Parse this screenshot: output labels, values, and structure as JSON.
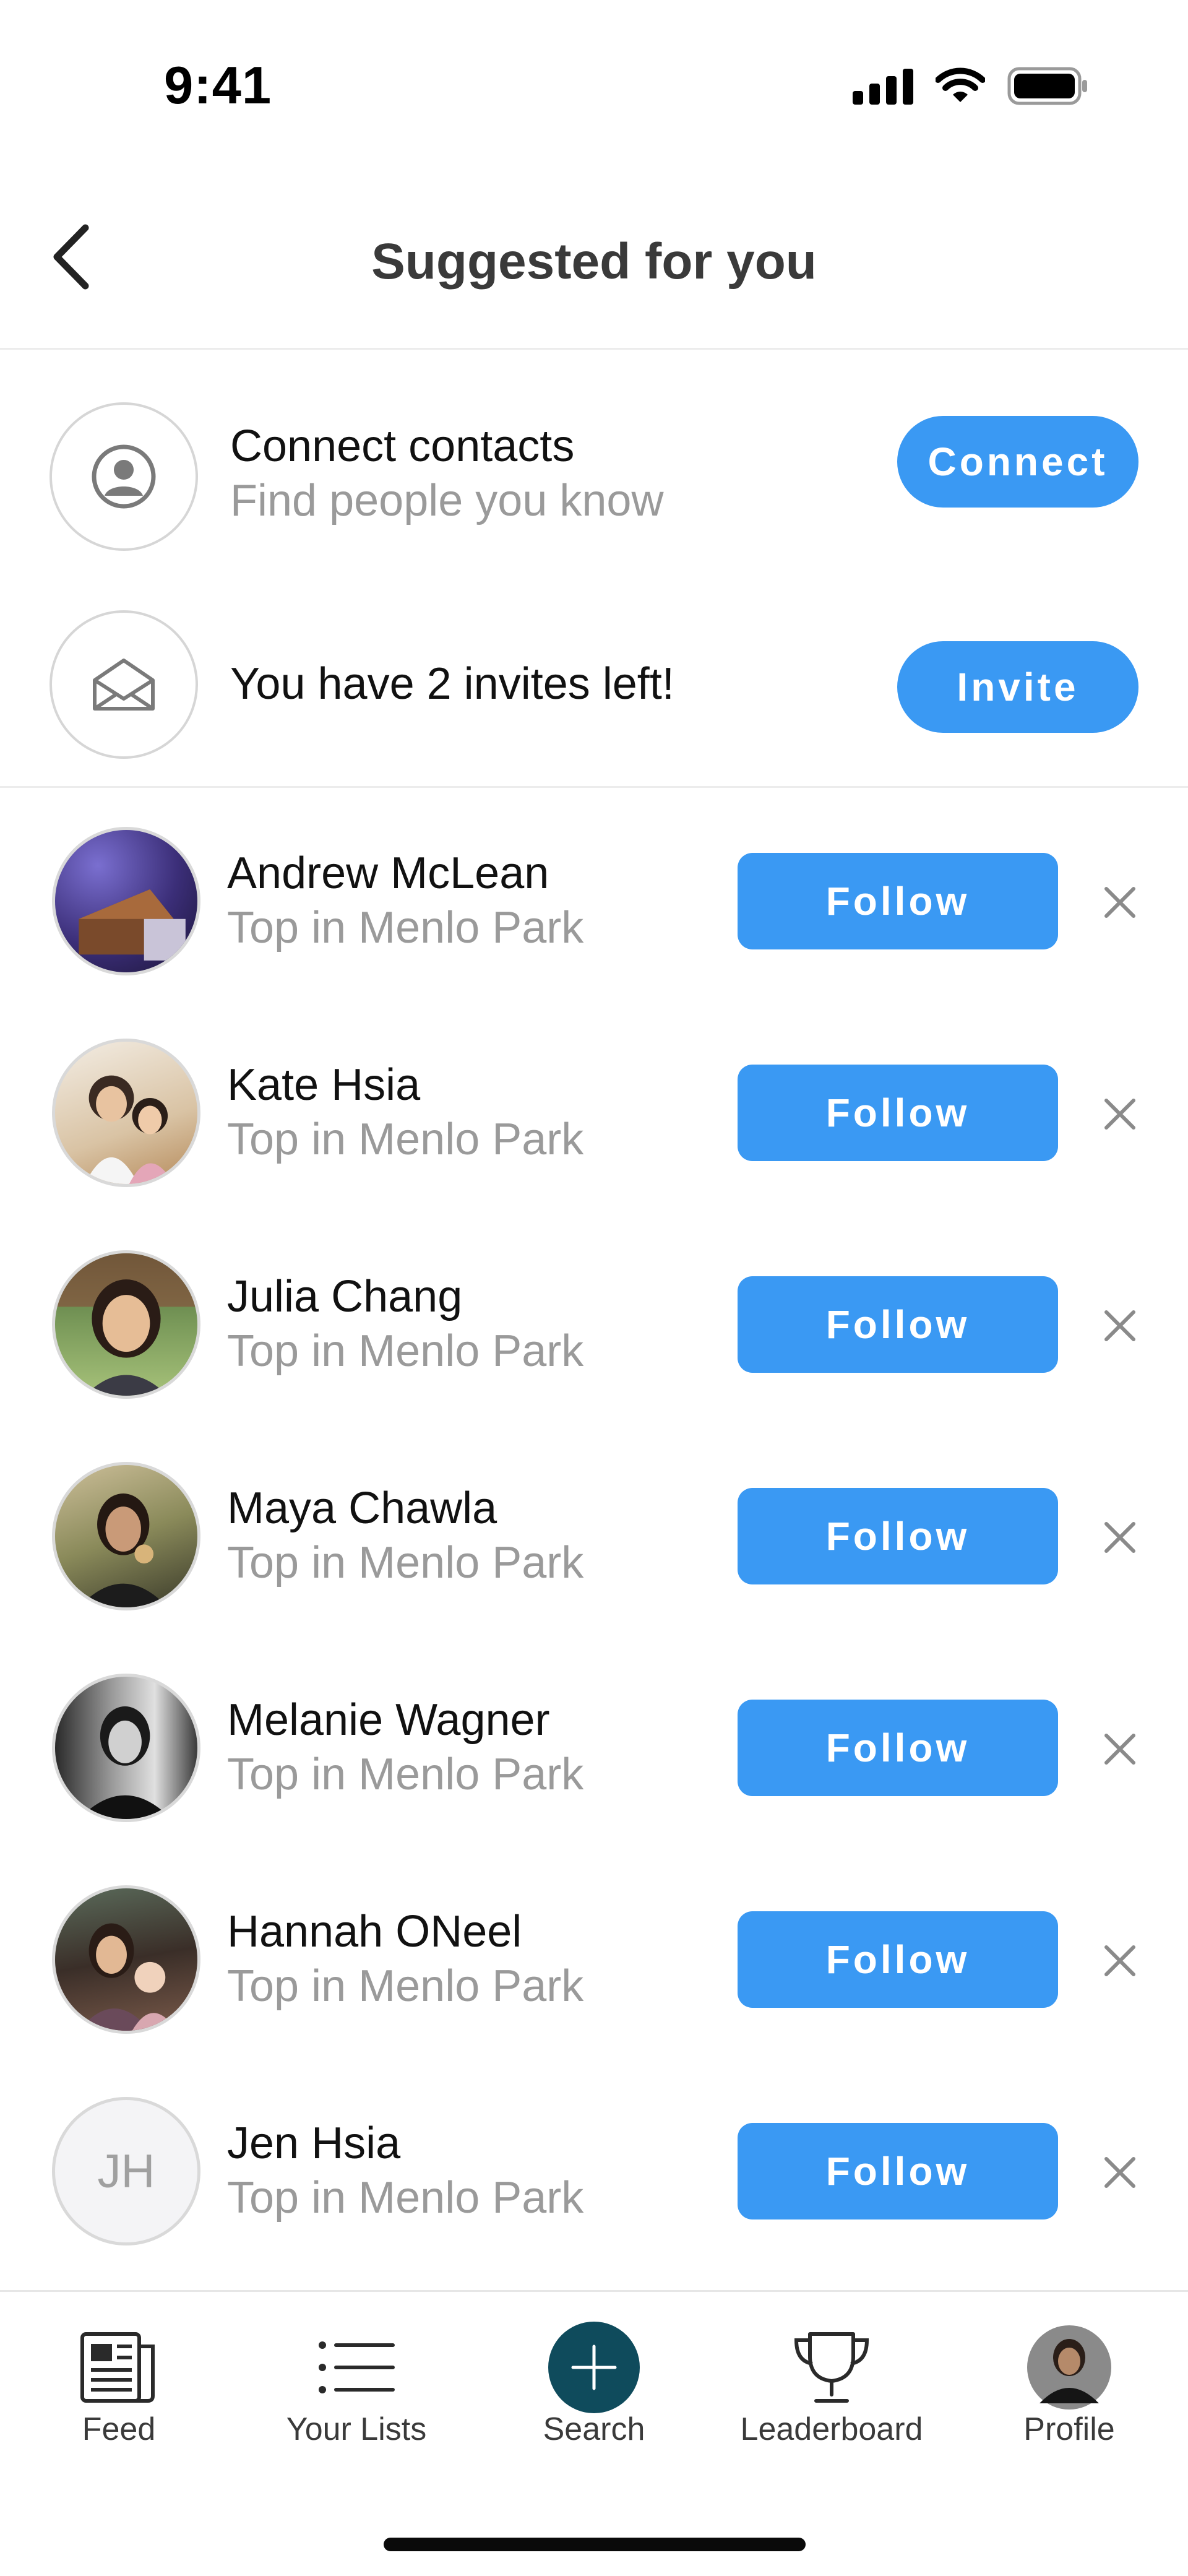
{
  "status_bar": {
    "time": "9:41"
  },
  "header": {
    "title": "Suggested for you"
  },
  "connect": {
    "title": "Connect contacts",
    "subtitle": "Find people you know",
    "button": "Connect"
  },
  "invite": {
    "title": "You have 2 invites left!",
    "button": "Invite"
  },
  "people": [
    {
      "name": "Andrew McLean",
      "subtitle": "Top in Menlo Park",
      "button": "Follow",
      "initials": ""
    },
    {
      "name": "Kate Hsia",
      "subtitle": "Top in Menlo Park",
      "button": "Follow",
      "initials": ""
    },
    {
      "name": "Julia Chang",
      "subtitle": "Top in Menlo Park",
      "button": "Follow",
      "initials": ""
    },
    {
      "name": "Maya Chawla",
      "subtitle": "Top in Menlo Park",
      "button": "Follow",
      "initials": ""
    },
    {
      "name": "Melanie Wagner",
      "subtitle": "Top in Menlo Park",
      "button": "Follow",
      "initials": ""
    },
    {
      "name": "Hannah ONeel",
      "subtitle": "Top in Menlo Park",
      "button": "Follow",
      "initials": ""
    },
    {
      "name": "Jen Hsia",
      "subtitle": "Top in Menlo Park",
      "button": "Follow",
      "initials": "JH"
    }
  ],
  "tabs": [
    {
      "label": "Feed",
      "icon": "newspaper-icon"
    },
    {
      "label": "Your Lists",
      "icon": "list-icon"
    },
    {
      "label": "Search",
      "icon": "plus-icon"
    },
    {
      "label": "Leaderboard",
      "icon": "trophy-icon"
    },
    {
      "label": "Profile",
      "icon": "profile-avatar"
    }
  ],
  "colors": {
    "accent": "#3a99f3",
    "search_fab": "#0f4b5c",
    "muted_text": "#9a9a9a"
  }
}
